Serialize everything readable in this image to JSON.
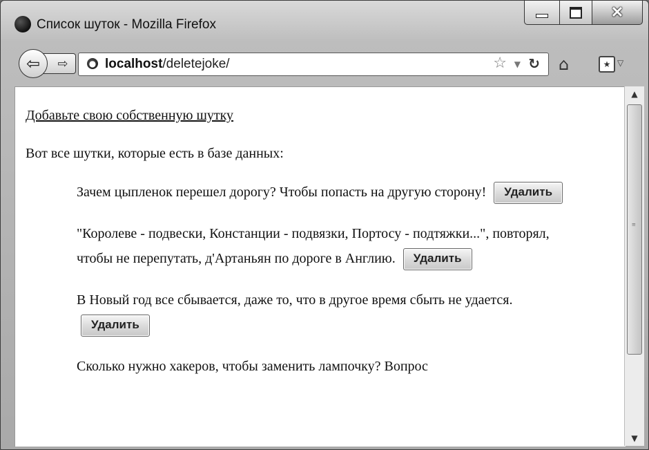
{
  "window": {
    "title": "Список шуток - Mozilla Firefox"
  },
  "toolbar": {
    "url_host": "localhost",
    "url_path": "/deletejoke/"
  },
  "page": {
    "add_link": "Добавьте свою собственную шутку",
    "intro": "Вот все шутки, которые есть в базе данных:",
    "delete_label": "Удалить",
    "jokes": [
      {
        "text": "Зачем цыпленок перешел дорогу? Чтобы попасть на другую сторону!"
      },
      {
        "text": "\"Королеве - подвески, Констанции - подвязки, Портосу - подтяжки...\", повторял, чтобы не перепутать, д'Артаньян по дороге в Англию."
      },
      {
        "text": "В Новый год все сбывается, даже то, что в другое время сбыть не удается."
      },
      {
        "text": "Сколько нужно хакеров, чтобы заменить лампочку? Вопрос"
      }
    ]
  },
  "icons": {
    "app": "firefox-logo-icon",
    "back": "back-arrow-icon",
    "forward": "forward-arrow-icon",
    "site": "globe-icon",
    "bookmark": "star-icon",
    "reload": "reload-icon",
    "home": "home-icon",
    "bookmarks_menu": "bookmarks-menu-icon"
  }
}
